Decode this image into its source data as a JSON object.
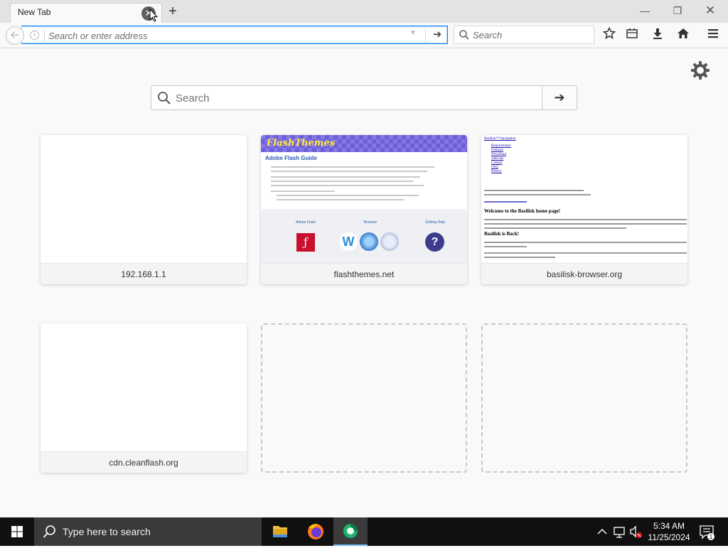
{
  "browser": {
    "tab_title": "New Tab",
    "url_placeholder": "Search or enter address",
    "search_placeholder": "Search"
  },
  "newtab": {
    "search_placeholder": "Search",
    "tiles": [
      {
        "label": "192.168.1.1"
      },
      {
        "label": "flashthemes.net"
      },
      {
        "label": "basilisk-browser.org"
      },
      {
        "label": "cdn.cleanflash.org"
      }
    ],
    "flash_thumb": {
      "logo": "FlashThemes",
      "title": "Adobe Flash Guide",
      "cols": [
        "Adobe Flash",
        "Browser",
        "Getting Help"
      ]
    },
    "basilisk_thumb": {
      "header": "Basilisk™ Navigation",
      "links": [
        "Requirements",
        "Features",
        "Download",
        "Add-ons",
        "Contact",
        "FAQ",
        "History"
      ],
      "heading1": "Welcome to the Basilisk home page!",
      "heading2": "Basilisk is Back!"
    }
  },
  "taskbar": {
    "search_placeholder": "Type here to search",
    "time": "5:34 AM",
    "date": "11/25/2024",
    "notification_count": "1"
  },
  "icons": [
    "back-icon",
    "info-icon",
    "go-arrow-icon",
    "search-icon",
    "bookmark-star-icon",
    "library-icon",
    "download-icon",
    "home-icon",
    "menu-icon",
    "gear-icon",
    "windows-icon",
    "file-explorer-icon",
    "firefox-icon",
    "app-icon"
  ],
  "colors": {
    "accent": "#0a84ff",
    "taskbar": "#101010"
  }
}
